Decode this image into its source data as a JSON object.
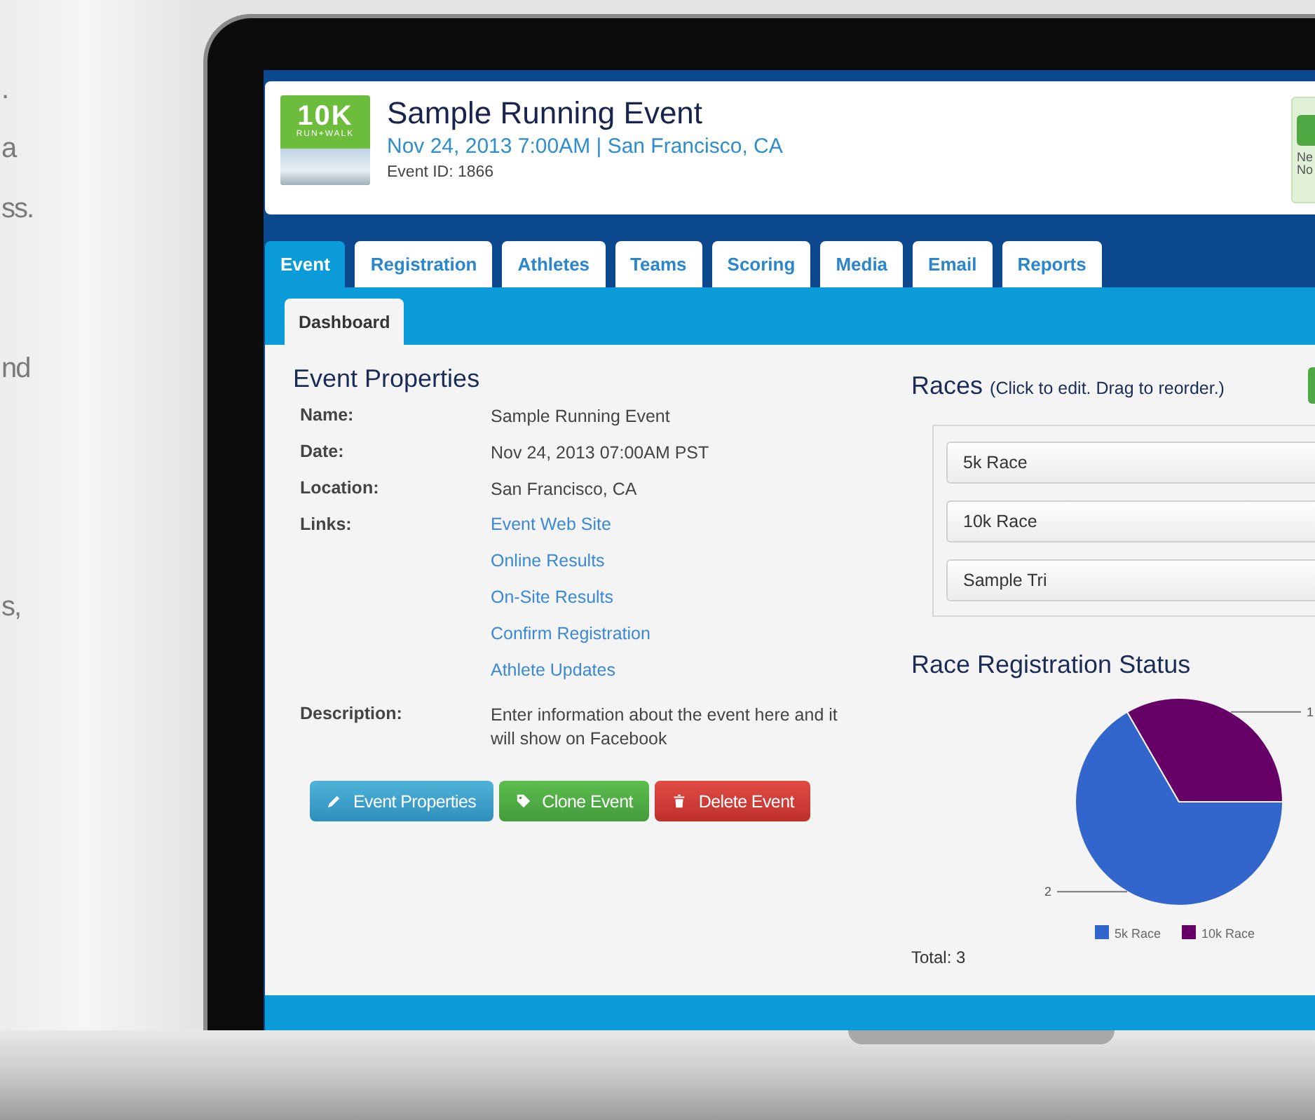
{
  "side_text": [
    ".",
    "a",
    "ss.",
    "nd",
    "s,"
  ],
  "event": {
    "title": "Sample Running Event",
    "subtitle": "Nov 24, 2013 7:00AM | San Francisco, CA",
    "event_id": "Event ID: 1866",
    "logo_text": "10K",
    "logo_subtext": "RUN+WALK",
    "status_lines": [
      "Ne",
      "No"
    ]
  },
  "tabs": [
    {
      "label": "Event",
      "selected": true
    },
    {
      "label": "Registration",
      "selected": false
    },
    {
      "label": "Athletes",
      "selected": false
    },
    {
      "label": "Teams",
      "selected": false
    },
    {
      "label": "Scoring",
      "selected": false
    },
    {
      "label": "Media",
      "selected": false
    },
    {
      "label": "Email",
      "selected": false
    },
    {
      "label": "Reports",
      "selected": false
    }
  ],
  "subtabs": [
    {
      "label": "Dashboard",
      "selected": true
    }
  ],
  "properties": {
    "title": "Event Properties",
    "rows": [
      {
        "kind": "text",
        "label": "Name:",
        "value": "Sample Running Event"
      },
      {
        "kind": "text",
        "label": "Date:",
        "value": "Nov 24, 2013 07:00AM PST"
      },
      {
        "kind": "text",
        "label": "Location:",
        "value": "San Francisco, CA"
      },
      {
        "kind": "links",
        "label": "Links:",
        "links": [
          "Event Web Site",
          "Online Results",
          "On-Site Results",
          "Confirm Registration",
          "Athlete Updates"
        ]
      },
      {
        "kind": "text",
        "label": "Description:",
        "value": "Enter information about the event here and it will show on Facebook"
      }
    ]
  },
  "buttons": [
    {
      "kind": "info",
      "label": "Event Properties"
    },
    {
      "kind": "success",
      "label": "Clone Event"
    },
    {
      "kind": "danger",
      "label": "Delete Event"
    }
  ],
  "races": {
    "title": "Races",
    "hint": "(Click to edit. Drag to reorder.)",
    "items": [
      "5k Race",
      "10k Race",
      "Sample Tri"
    ]
  },
  "registration": {
    "title": "Race Registration Status",
    "total": "Total: 3",
    "chart_data": {
      "type": "pie",
      "categories": [
        "5k Race",
        "10k Race"
      ],
      "series": [
        {
          "values": [
            2,
            1
          ]
        }
      ],
      "legend": "bottom",
      "data_labels": true
    }
  }
}
